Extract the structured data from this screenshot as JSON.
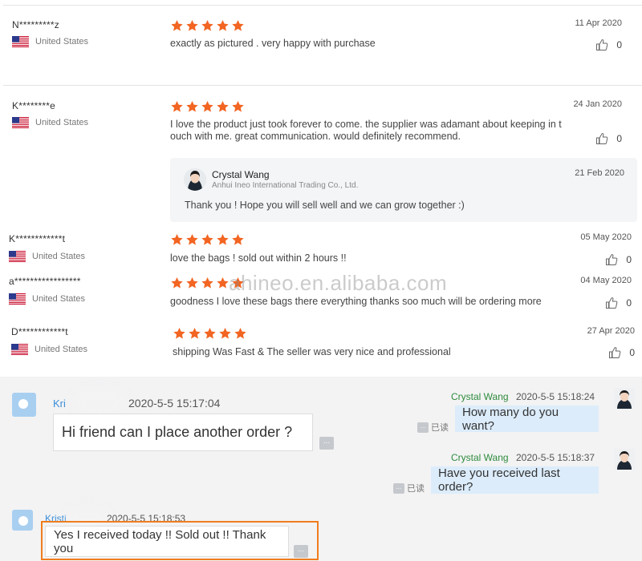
{
  "reviews": [
    {
      "user": "N*********z",
      "country": "United States",
      "rating": 5,
      "text": "exactly as pictured . very happy with purchase",
      "date": "11 Apr 2020",
      "likes": "0"
    },
    {
      "user": "K********e",
      "country": "United States",
      "rating": 5,
      "text_line1": "I love the product just took forever to come. the supplier was adamant about keeping in t",
      "text_line2": "ouch with me. great communication. would definitely recommend.",
      "date": "24 Jan 2020",
      "likes": "0",
      "reply": {
        "name": "Crystal Wang",
        "company": "Anhui Ineo International Trading Co., Ltd.",
        "date": "21 Feb 2020",
        "text": "Thank you ! Hope you will sell well and we can grow together :)"
      }
    },
    {
      "user": "K************t",
      "country": "United States",
      "rating": 5,
      "text": "love the bags ! sold out within 2 hours !!",
      "date": "05 May 2020",
      "likes": "0"
    },
    {
      "user": "a*****************",
      "country": "United States",
      "rating": 5,
      "text": "goodness I love these bags there everything thanks soo much will be ordering more",
      "date": "04 May 2020",
      "likes": "0"
    },
    {
      "user": "D************t",
      "country": "United States",
      "rating": 5,
      "text": "shipping  Was Fast & The seller was very nice and professional",
      "date": "27 Apr 2020",
      "likes": "0"
    }
  ],
  "watermark": "ahineo.en.alibaba.com",
  "chat": {
    "messages": [
      {
        "sender": "Kri",
        "time": "2020-5-5 15:17:04",
        "text": "Hi friend can I place another order ?"
      },
      {
        "sender": "Crystal Wang",
        "time": "2020-5-5 15:18:24",
        "text": "How many do you want?",
        "read": "已读"
      },
      {
        "sender": "Crystal Wang",
        "time": "2020-5-5 15:18:37",
        "text": "Have you received last order?",
        "read": "已读"
      },
      {
        "sender": "Kristi",
        "time": "2020-5-5 15:18:53",
        "text": "Yes I received today !! Sold out !! Thank you"
      }
    ],
    "more_glyph": "..."
  },
  "colors": {
    "star": "#f26522",
    "accent_blue": "#3b8fd8",
    "seller_green": "#2e8b3c",
    "highlight": "#ef7d1d"
  },
  "icons": [
    "us-flag-icon",
    "star-icon",
    "thumbs-up-icon",
    "more-icon"
  ]
}
